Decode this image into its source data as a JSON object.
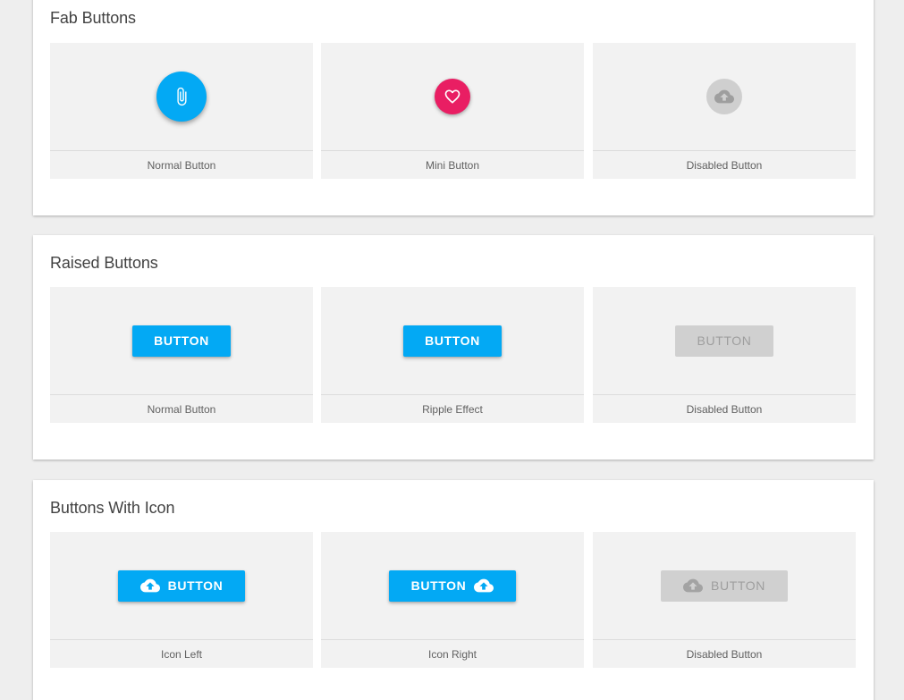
{
  "colors": {
    "primary": "#03a9f4",
    "accent": "#e91e63",
    "disabled_bg": "#d0d0d0",
    "disabled_text": "#9e9e9e",
    "cell_bg": "#f2f2f2",
    "page_bg": "#eeeeee"
  },
  "sections": [
    {
      "title": "Fab Buttons",
      "items": [
        {
          "caption": "Normal Button",
          "icon": "paperclip-icon"
        },
        {
          "caption": "Mini Button",
          "icon": "heart-icon"
        },
        {
          "caption": "Disabled Button",
          "icon": "cloud-upload-icon"
        }
      ]
    },
    {
      "title": "Raised Buttons",
      "items": [
        {
          "caption": "Normal Button",
          "label": "BUTTON"
        },
        {
          "caption": "Ripple Effect",
          "label": "BUTTON"
        },
        {
          "caption": "Disabled Button",
          "label": "BUTTON"
        }
      ]
    },
    {
      "title": "Buttons With Icon",
      "items": [
        {
          "caption": "Icon Left",
          "label": "BUTTON",
          "icon": "cloud-upload-icon"
        },
        {
          "caption": "Icon Right",
          "label": "BUTTON",
          "icon": "cloud-upload-icon"
        },
        {
          "caption": "Disabled Button",
          "label": "BUTTON",
          "icon": "cloud-upload-icon"
        }
      ]
    }
  ]
}
